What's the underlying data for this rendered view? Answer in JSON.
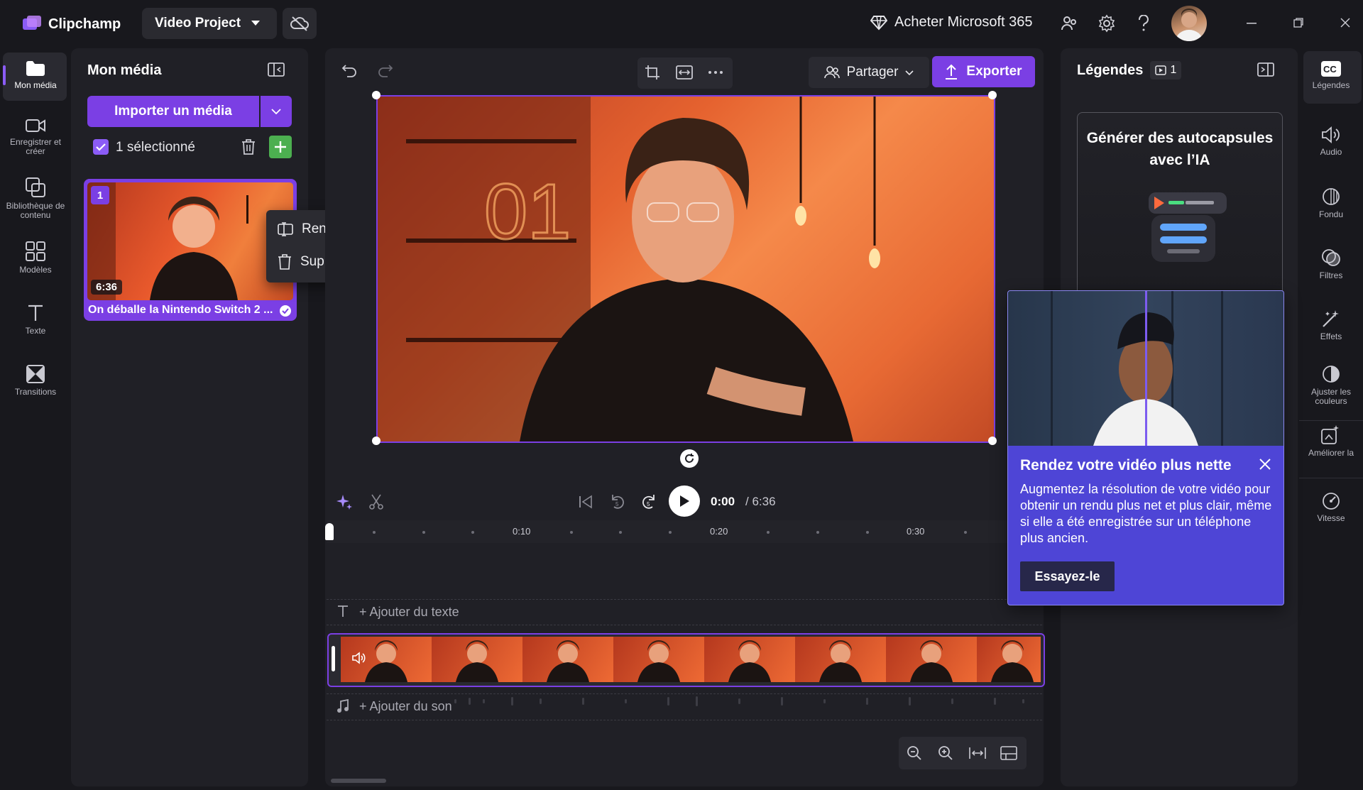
{
  "app": {
    "name": "Clipchamp",
    "project_title": "Video Project",
    "buy_label": "Acheter Microsoft 365"
  },
  "left_rail": {
    "items": [
      {
        "label": "Mon média",
        "icon": "folder-icon"
      },
      {
        "label": "Enregistrer et créer",
        "icon": "camera-icon"
      },
      {
        "label": "Bibliothèque de contenu",
        "icon": "library-icon"
      },
      {
        "label": "Modèles",
        "icon": "templates-icon"
      },
      {
        "label": "Texte",
        "icon": "text-icon"
      },
      {
        "label": "Transitions",
        "icon": "transitions-icon"
      }
    ]
  },
  "media_panel": {
    "title": "Mon média",
    "import_label": "Importer un média",
    "selected_label": "1 sélectionné",
    "media_item": {
      "index": "1",
      "duration": "6:36",
      "title": "On déballe la Nintendo Switch 2 ..."
    },
    "context_menu": {
      "rename": "Renommer",
      "delete": "Supprimer"
    }
  },
  "preview": {
    "share_label": "Partager",
    "export_label": "Exporter",
    "current_time": "0:00",
    "total_time": "/ 6:36"
  },
  "timeline": {
    "ticks": [
      "0:10",
      "0:20",
      "0:30"
    ],
    "add_text": "+ Ajouter du texte",
    "add_audio": "+ Ajouter du son"
  },
  "captions_panel": {
    "title": "Légendes",
    "count": "1",
    "promo_title": "Générer des autocapsules avec l’IA"
  },
  "tooltip": {
    "title": "Rendez votre vidéo plus nette",
    "body": "Augmentez la résolution de votre vidéo pour obtenir un rendu plus net et plus clair, même si elle a été enregistrée sur un téléphone plus ancien.",
    "button": "Essayez-le"
  },
  "right_rail": {
    "items": [
      {
        "label": "Légendes",
        "icon": "cc-icon"
      },
      {
        "label": "Audio",
        "icon": "speaker-icon"
      },
      {
        "label": "Fondu",
        "icon": "fade-icon"
      },
      {
        "label": "Filtres",
        "icon": "filters-icon"
      },
      {
        "label": "Effets",
        "icon": "effects-icon"
      },
      {
        "label": "Ajuster les couleurs",
        "icon": "contrast-icon"
      },
      {
        "label": "Améliorer la",
        "icon": "enhance-icon"
      },
      {
        "label": "Vitesse",
        "icon": "speed-icon"
      }
    ]
  },
  "colors": {
    "accent": "#7b3fe4",
    "background": "#18181d",
    "panel": "#202026",
    "tooltip": "#4e45d6"
  }
}
